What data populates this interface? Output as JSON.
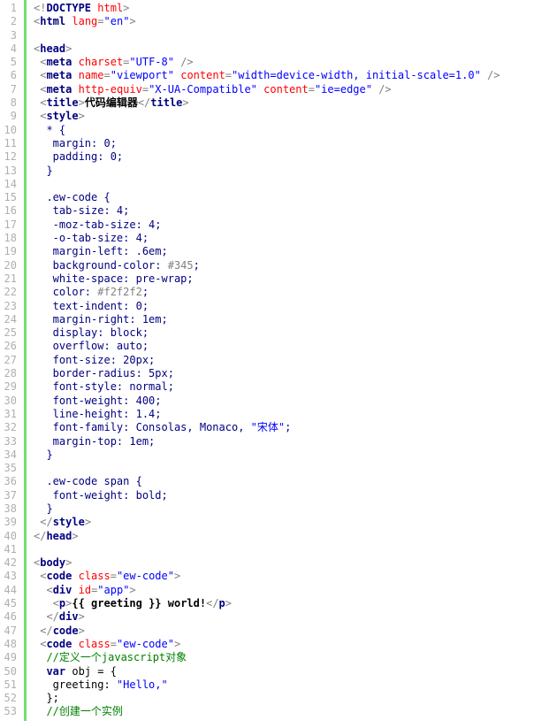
{
  "lines": [
    {
      "n": 1,
      "seg": [
        [
          "t-tag",
          "<!"
        ],
        [
          "t-name",
          "DOCTYPE"
        ],
        [
          "t-txt",
          " "
        ],
        [
          "t-attr",
          "html"
        ],
        [
          "t-tag",
          ">"
        ]
      ]
    },
    {
      "n": 2,
      "seg": [
        [
          "t-tag",
          "<"
        ],
        [
          "t-name",
          "html"
        ],
        [
          "t-txt",
          " "
        ],
        [
          "t-attr",
          "lang"
        ],
        [
          "t-tag",
          "="
        ],
        [
          "t-val",
          "\"en\""
        ],
        [
          "t-tag",
          ">"
        ]
      ]
    },
    {
      "n": 3,
      "seg": []
    },
    {
      "n": 4,
      "seg": [
        [
          "t-tag",
          "<"
        ],
        [
          "t-name",
          "head"
        ],
        [
          "t-tag",
          ">"
        ]
      ]
    },
    {
      "n": 5,
      "seg": [
        [
          "",
          ""
        ],
        [
          "t-tag",
          " <"
        ],
        [
          "t-name",
          "meta"
        ],
        [
          "t-txt",
          " "
        ],
        [
          "t-attr",
          "charset"
        ],
        [
          "t-tag",
          "="
        ],
        [
          "t-val",
          "\"UTF-8\""
        ],
        [
          "t-tag",
          " />"
        ]
      ]
    },
    {
      "n": 6,
      "seg": [
        [
          "t-tag",
          " <"
        ],
        [
          "t-name",
          "meta"
        ],
        [
          "t-txt",
          " "
        ],
        [
          "t-attr",
          "name"
        ],
        [
          "t-tag",
          "="
        ],
        [
          "t-val",
          "\"viewport\""
        ],
        [
          "t-txt",
          " "
        ],
        [
          "t-attr",
          "content"
        ],
        [
          "t-tag",
          "="
        ],
        [
          "t-val",
          "\"width=device-width, initial-scale=1.0\""
        ],
        [
          "t-tag",
          " />"
        ]
      ]
    },
    {
      "n": 7,
      "seg": [
        [
          "t-tag",
          " <"
        ],
        [
          "t-name",
          "meta"
        ],
        [
          "t-txt",
          " "
        ],
        [
          "t-attr",
          "http-equiv"
        ],
        [
          "t-tag",
          "="
        ],
        [
          "t-val",
          "\"X-UA-Compatible\""
        ],
        [
          "t-txt",
          " "
        ],
        [
          "t-attr",
          "content"
        ],
        [
          "t-tag",
          "="
        ],
        [
          "t-val",
          "\"ie=edge\""
        ],
        [
          "t-tag",
          " />"
        ]
      ]
    },
    {
      "n": 8,
      "seg": [
        [
          "t-tag",
          " <"
        ],
        [
          "t-name",
          "title"
        ],
        [
          "t-tag",
          ">"
        ],
        [
          "t-txt",
          "代码编辑器"
        ],
        [
          "t-tag",
          "</"
        ],
        [
          "t-name",
          "title"
        ],
        [
          "t-tag",
          ">"
        ]
      ]
    },
    {
      "n": 9,
      "seg": [
        [
          "t-tag",
          " <"
        ],
        [
          "t-name",
          "style"
        ],
        [
          "t-tag",
          ">"
        ]
      ]
    },
    {
      "n": 10,
      "seg": [
        [
          "t-css",
          "  * {"
        ]
      ]
    },
    {
      "n": 11,
      "seg": [
        [
          "t-css",
          "   margin: 0;"
        ]
      ]
    },
    {
      "n": 12,
      "seg": [
        [
          "t-css",
          "   padding: 0;"
        ]
      ]
    },
    {
      "n": 13,
      "seg": [
        [
          "t-css",
          "  }"
        ]
      ]
    },
    {
      "n": 14,
      "seg": []
    },
    {
      "n": 15,
      "seg": [
        [
          "t-css",
          "  .ew-code {"
        ]
      ]
    },
    {
      "n": 16,
      "seg": [
        [
          "t-css",
          "   tab-size: 4;"
        ]
      ]
    },
    {
      "n": 17,
      "seg": [
        [
          "t-css",
          "   -moz-tab-size: 4;"
        ]
      ]
    },
    {
      "n": 18,
      "seg": [
        [
          "t-css",
          "   -o-tab-size: 4;"
        ]
      ]
    },
    {
      "n": 19,
      "seg": [
        [
          "t-css",
          "   margin-left: .6em;"
        ]
      ]
    },
    {
      "n": 20,
      "seg": [
        [
          "t-css",
          "   background-color: "
        ],
        [
          "t-hex",
          "#345"
        ],
        [
          "t-css",
          ";"
        ]
      ]
    },
    {
      "n": 21,
      "seg": [
        [
          "t-css",
          "   white-space: pre-wrap;"
        ]
      ]
    },
    {
      "n": 22,
      "seg": [
        [
          "t-css",
          "   color: "
        ],
        [
          "t-hex",
          "#f2f2f2"
        ],
        [
          "t-css",
          ";"
        ]
      ]
    },
    {
      "n": 23,
      "seg": [
        [
          "t-css",
          "   text-indent: 0;"
        ]
      ]
    },
    {
      "n": 24,
      "seg": [
        [
          "t-css",
          "   margin-right: 1em;"
        ]
      ]
    },
    {
      "n": 25,
      "seg": [
        [
          "t-css",
          "   display: block;"
        ]
      ]
    },
    {
      "n": 26,
      "seg": [
        [
          "t-css",
          "   overflow: auto;"
        ]
      ]
    },
    {
      "n": 27,
      "seg": [
        [
          "t-css",
          "   font-size: 20px;"
        ]
      ]
    },
    {
      "n": 28,
      "seg": [
        [
          "t-css",
          "   border-radius: 5px;"
        ]
      ]
    },
    {
      "n": 29,
      "seg": [
        [
          "t-css",
          "   font-style: normal;"
        ]
      ]
    },
    {
      "n": 30,
      "seg": [
        [
          "t-css",
          "   font-weight: 400;"
        ]
      ]
    },
    {
      "n": 31,
      "seg": [
        [
          "t-css",
          "   line-height: 1.4;"
        ]
      ]
    },
    {
      "n": 32,
      "seg": [
        [
          "t-css",
          "   font-family: Consolas, Monaco, "
        ],
        [
          "t-val",
          "\"宋体\""
        ],
        [
          "t-css",
          ";"
        ]
      ]
    },
    {
      "n": 33,
      "seg": [
        [
          "t-css",
          "   margin-top: 1em;"
        ]
      ]
    },
    {
      "n": 34,
      "seg": [
        [
          "t-css",
          "  }"
        ]
      ]
    },
    {
      "n": 35,
      "seg": []
    },
    {
      "n": 36,
      "seg": [
        [
          "t-css",
          "  .ew-code span {"
        ]
      ]
    },
    {
      "n": 37,
      "seg": [
        [
          "t-css",
          "   font-weight: bold;"
        ]
      ]
    },
    {
      "n": 38,
      "seg": [
        [
          "t-css",
          "  }"
        ]
      ]
    },
    {
      "n": 39,
      "seg": [
        [
          "t-tag",
          " </"
        ],
        [
          "t-name",
          "style"
        ],
        [
          "t-tag",
          ">"
        ]
      ]
    },
    {
      "n": 40,
      "seg": [
        [
          "t-tag",
          "</"
        ],
        [
          "t-name",
          "head"
        ],
        [
          "t-tag",
          ">"
        ]
      ]
    },
    {
      "n": 41,
      "seg": []
    },
    {
      "n": 42,
      "seg": [
        [
          "t-tag",
          "<"
        ],
        [
          "t-name",
          "body"
        ],
        [
          "t-tag",
          ">"
        ]
      ]
    },
    {
      "n": 43,
      "seg": [
        [
          "t-tag",
          " <"
        ],
        [
          "t-name",
          "code"
        ],
        [
          "t-txt",
          " "
        ],
        [
          "t-attr",
          "class"
        ],
        [
          "t-tag",
          "="
        ],
        [
          "t-val",
          "\"ew-code\""
        ],
        [
          "t-tag",
          ">"
        ]
      ]
    },
    {
      "n": 44,
      "seg": [
        [
          "t-tag",
          "  <"
        ],
        [
          "t-name",
          "div"
        ],
        [
          "t-txt",
          " "
        ],
        [
          "t-attr",
          "id"
        ],
        [
          "t-tag",
          "="
        ],
        [
          "t-val",
          "\"app\""
        ],
        [
          "t-tag",
          ">"
        ]
      ]
    },
    {
      "n": 45,
      "seg": [
        [
          "t-tag",
          "   <"
        ],
        [
          "t-name",
          "p"
        ],
        [
          "t-tag",
          ">"
        ],
        [
          "t-txt",
          "{{ greeting }} world!"
        ],
        [
          "t-tag",
          "</"
        ],
        [
          "t-name",
          "p"
        ],
        [
          "t-tag",
          ">"
        ]
      ]
    },
    {
      "n": 46,
      "seg": [
        [
          "t-tag",
          "  </"
        ],
        [
          "t-name",
          "div"
        ],
        [
          "t-tag",
          ">"
        ]
      ]
    },
    {
      "n": 47,
      "seg": [
        [
          "t-tag",
          " </"
        ],
        [
          "t-name",
          "code"
        ],
        [
          "t-tag",
          ">"
        ]
      ]
    },
    {
      "n": 48,
      "seg": [
        [
          "t-tag",
          " <"
        ],
        [
          "t-name",
          "code"
        ],
        [
          "t-txt",
          " "
        ],
        [
          "t-attr",
          "class"
        ],
        [
          "t-tag",
          "="
        ],
        [
          "t-val",
          "\"ew-code\""
        ],
        [
          "t-tag",
          ">"
        ]
      ]
    },
    {
      "n": 49,
      "seg": [
        [
          "",
          "  "
        ],
        [
          "t-com",
          "//定义一个javascript对象"
        ]
      ]
    },
    {
      "n": 50,
      "seg": [
        [
          "",
          "  "
        ],
        [
          "t-kw",
          "var"
        ],
        [
          "",
          " obj = {"
        ]
      ]
    },
    {
      "n": 51,
      "seg": [
        [
          "",
          "   greeting: "
        ],
        [
          "t-str",
          "\"Hello,\""
        ]
      ]
    },
    {
      "n": 52,
      "seg": [
        [
          "",
          "  };"
        ]
      ]
    },
    {
      "n": 53,
      "seg": [
        [
          "",
          "  "
        ],
        [
          "t-com",
          "//创建一个实例"
        ]
      ]
    }
  ]
}
